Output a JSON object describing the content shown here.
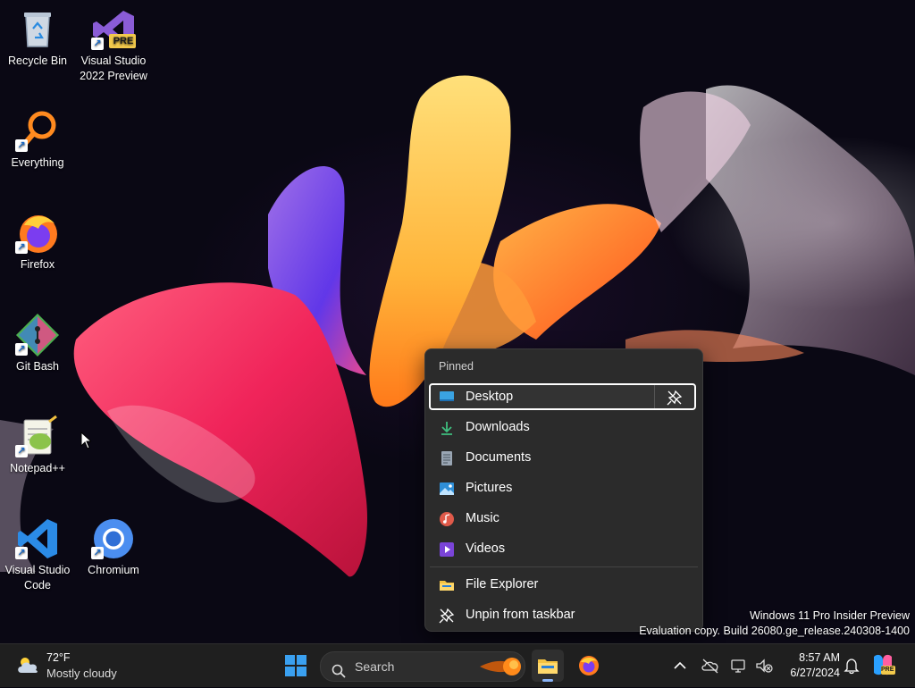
{
  "desktop": {
    "icons": [
      {
        "label": "Recycle Bin"
      },
      {
        "label": "Visual Studio 2022 Preview",
        "badge": "PRE"
      },
      {
        "label": "Everything"
      },
      {
        "label": "Firefox"
      },
      {
        "label": "Git Bash"
      },
      {
        "label": "Notepad++"
      },
      {
        "label": "Visual Studio Code"
      },
      {
        "label": "Chromium"
      }
    ]
  },
  "jumplist": {
    "header": "Pinned",
    "items": [
      {
        "label": "Desktop",
        "icon": "desktop-folder-icon",
        "selected": true
      },
      {
        "label": "Downloads",
        "icon": "download-arrow-icon"
      },
      {
        "label": "Documents",
        "icon": "document-icon"
      },
      {
        "label": "Pictures",
        "icon": "picture-icon"
      },
      {
        "label": "Music",
        "icon": "music-icon"
      },
      {
        "label": "Videos",
        "icon": "video-icon"
      }
    ],
    "actions": [
      {
        "label": "File Explorer",
        "icon": "folder-icon"
      },
      {
        "label": "Unpin from taskbar",
        "icon": "unpin-icon"
      }
    ]
  },
  "watermark": {
    "line1": "Windows 11 Pro Insider Preview",
    "line2": "Evaluation copy. Build 26080.ge_release.240308-1400"
  },
  "taskbar": {
    "weather": {
      "temp": "72°F",
      "condition": "Mostly cloudy"
    },
    "search_label": "Search",
    "clock": {
      "time": "8:57 AM",
      "date": "6/27/2024"
    },
    "copilot_badge": "PRE"
  },
  "colors": {
    "accent": "#8ab4f8",
    "menu_bg": "#2b2b2b",
    "taskbar_bg": "#1f1f1f"
  }
}
